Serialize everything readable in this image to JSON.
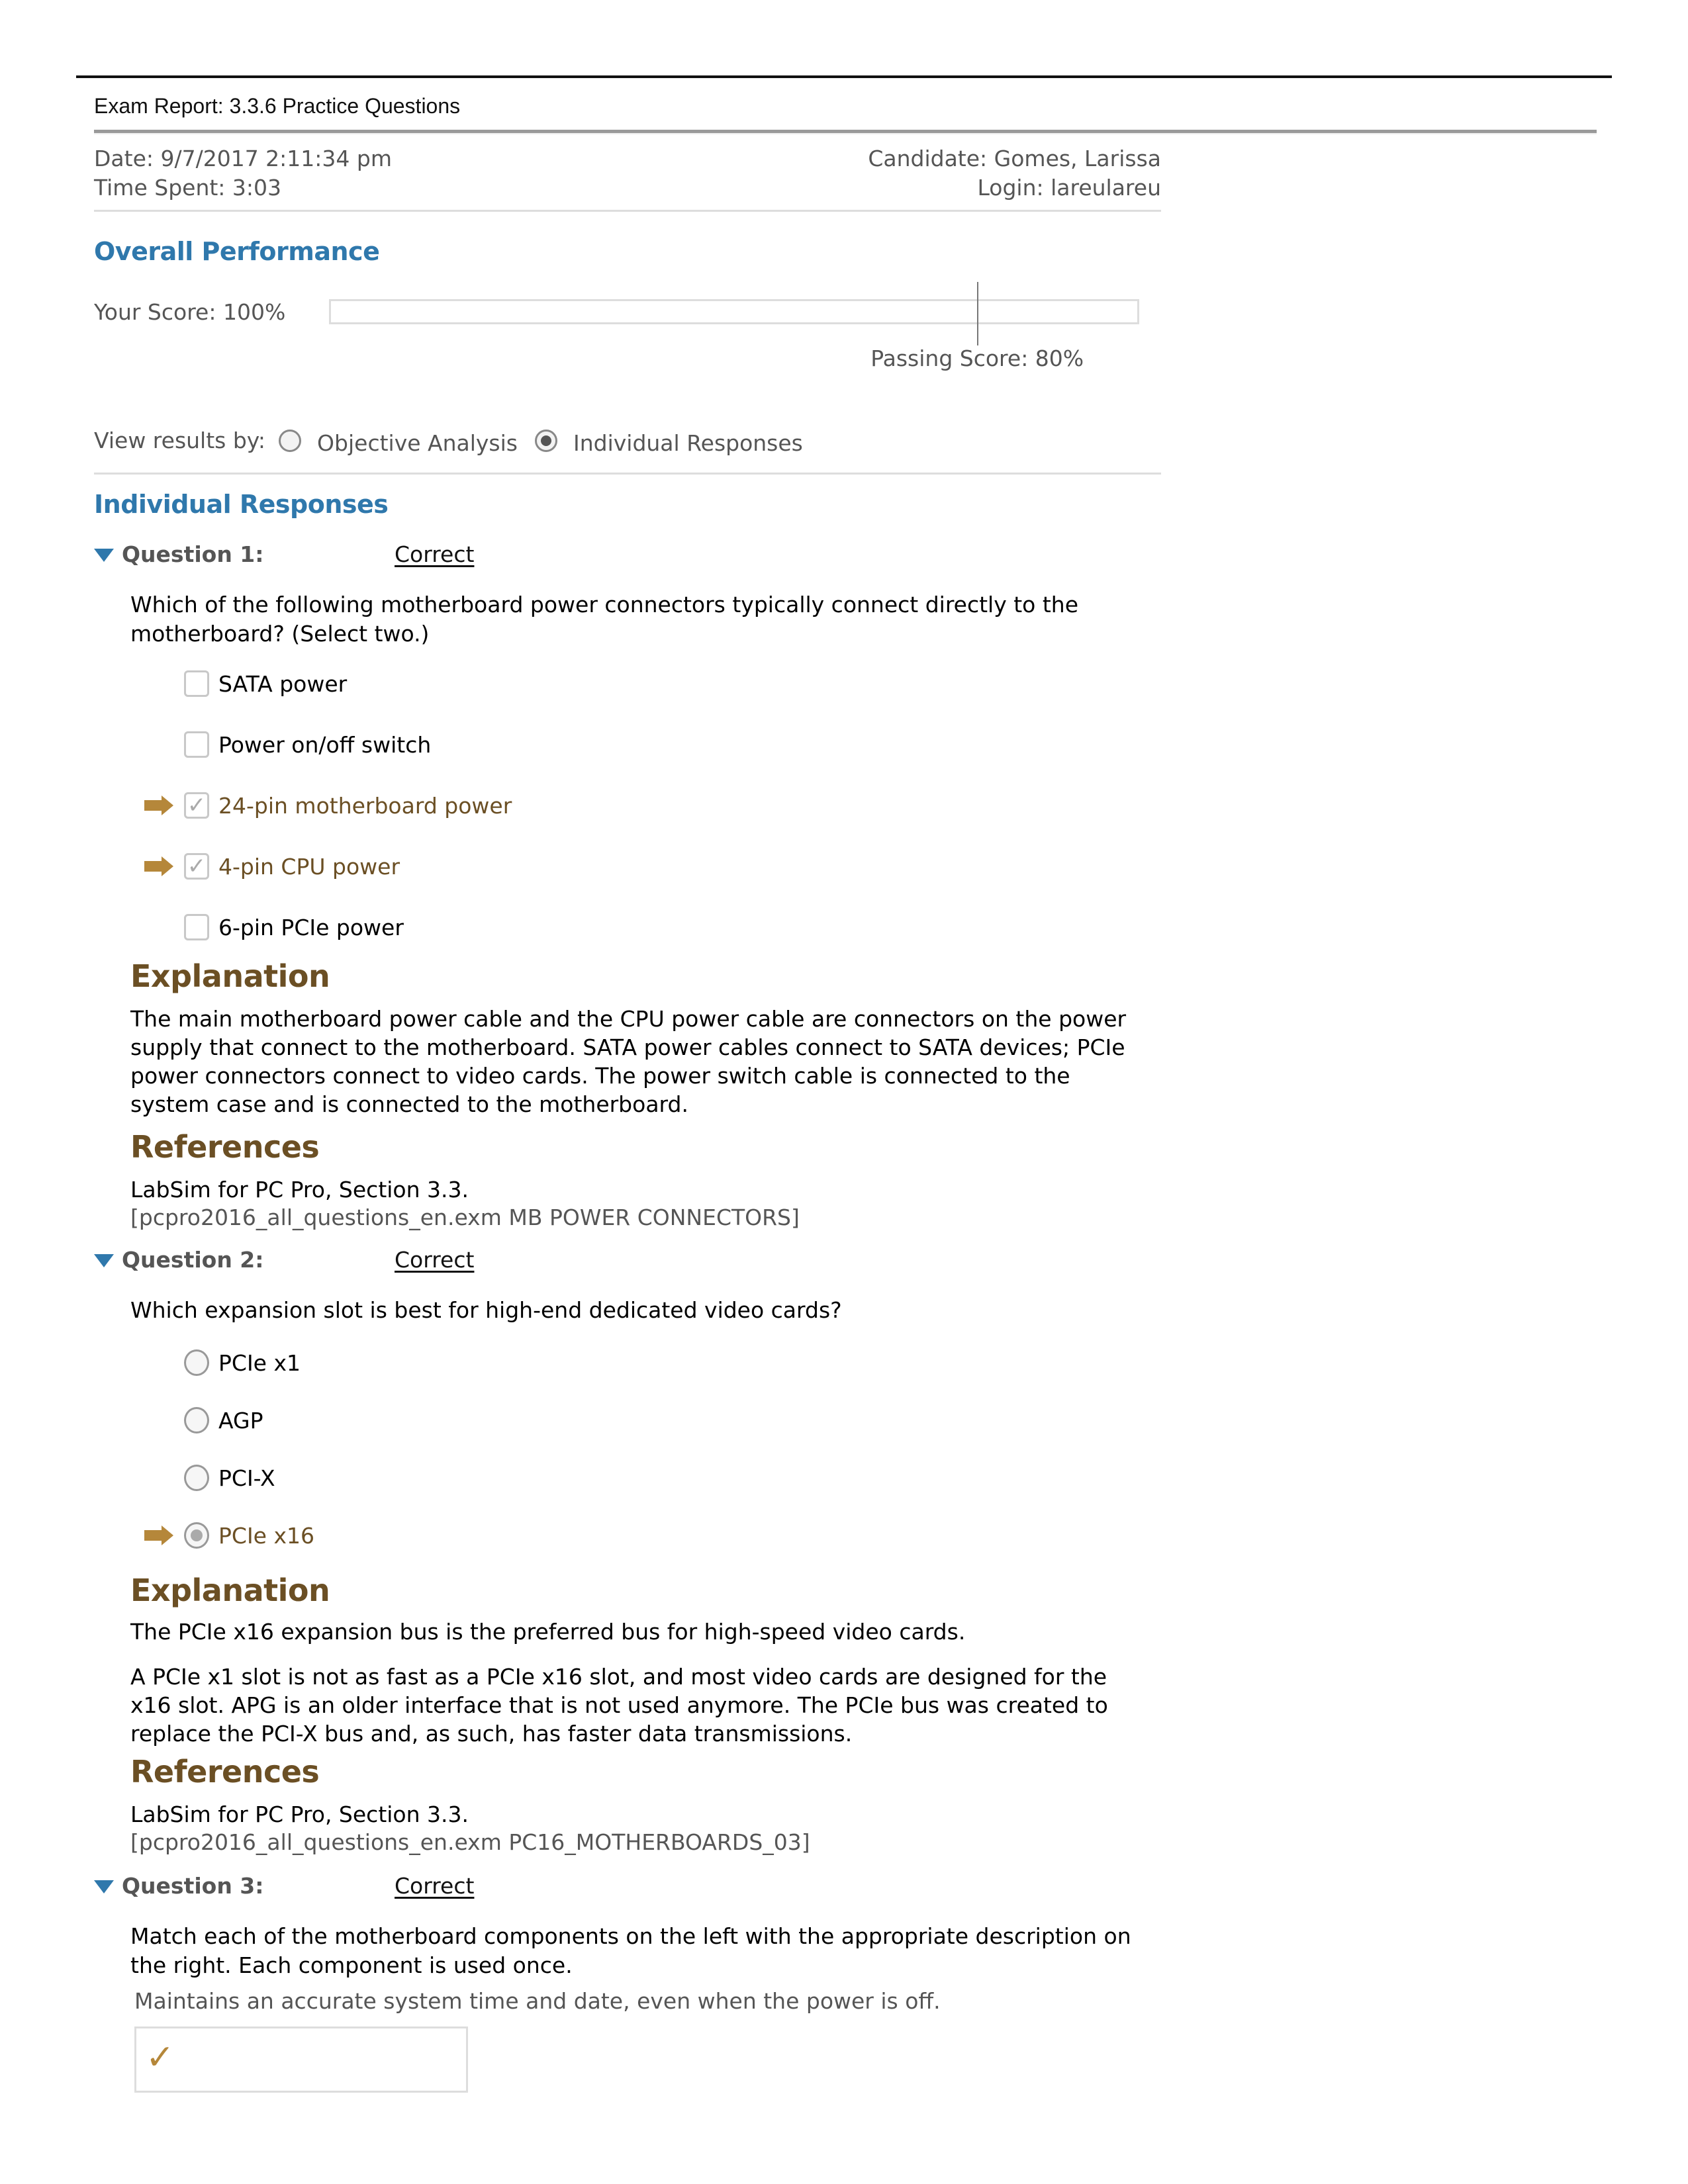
{
  "report": {
    "title": "Exam Report: 3.3.6 Practice Questions",
    "date": "Date: 9/7/2017 2:11:34 pm",
    "time_spent": "Time Spent: 3:03",
    "candidate": "Candidate: Gomes, Larissa",
    "login": "Login: lareulareu"
  },
  "overall": {
    "heading": "Overall Performance",
    "score_label": "Your Score: 100%",
    "score_percent": 100,
    "passing_label": "Passing Score: 80%",
    "passing_percent": 80
  },
  "view_results": {
    "label": "View results by:",
    "options": [
      {
        "label": "Objective Analysis",
        "selected": false
      },
      {
        "label": "Individual Responses",
        "selected": true
      }
    ]
  },
  "responses": {
    "heading": "Individual Responses",
    "explanation_heading": "Explanation",
    "references_heading": "References",
    "questions": [
      {
        "label": "Question 1:",
        "status": "Correct",
        "text": "Which of the following motherboard power connectors typically connect directly to the motherboard? (Select two.)",
        "input_type": "checkbox",
        "answers": [
          {
            "label": "SATA power",
            "checked": false,
            "correct": false
          },
          {
            "label": "Power on/off switch",
            "checked": false,
            "correct": false
          },
          {
            "label": "24-pin motherboard power",
            "checked": true,
            "correct": true
          },
          {
            "label": "4-pin CPU power",
            "checked": true,
            "correct": true
          },
          {
            "label": "6-pin PCIe power",
            "checked": false,
            "correct": false
          }
        ],
        "explanation": [
          "The main motherboard power cable and the CPU power cable are connectors on the power supply that connect to the motherboard. SATA power cables connect to SATA devices; PCIe power connectors connect to video cards. The power switch cable is connected to the system case and is connected to the motherboard."
        ],
        "reference": "LabSim for PC Pro, Section 3.3.",
        "reference_code": "[pcpro2016_all_questions_en.exm MB POWER CONNECTORS]"
      },
      {
        "label": "Question 2:",
        "status": "Correct",
        "text": "Which expansion slot is best for high-end dedicated video cards?",
        "input_type": "radio",
        "answers": [
          {
            "label": "PCIe x1",
            "checked": false,
            "correct": false
          },
          {
            "label": "AGP",
            "checked": false,
            "correct": false
          },
          {
            "label": "PCI-X",
            "checked": false,
            "correct": false
          },
          {
            "label": "PCIe x16",
            "checked": true,
            "correct": true
          }
        ],
        "explanation": [
          "The PCIe x16 expansion bus is the preferred bus for high-speed video cards.",
          "A PCIe x1 slot is not as fast as a PCIe x16 slot, and most video cards are designed for the x16 slot. APG is an older interface that is not used anymore. The PCIe bus was created to replace the PCI-X bus and, as such, has faster data transmissions."
        ],
        "reference": "LabSim for PC Pro, Section 3.3.",
        "reference_code": "[pcpro2016_all_questions_en.exm PC16_MOTHERBOARDS_03]"
      },
      {
        "label": "Question 3:",
        "status": "Correct",
        "text": "Match each of the motherboard components on the left with the appropriate description on the right. Each component is used once.",
        "input_type": "match",
        "match_items": [
          {
            "description": "Maintains an accurate system time and date, even when the power is off.",
            "result_icon": "checkmark-icon",
            "correct": true
          }
        ]
      }
    ]
  },
  "colors": {
    "heading_blue": "#2f78ac",
    "correct_brown": "#6b4f24",
    "arrow_gold": "#b5873a",
    "meta_gray": "#555555"
  }
}
